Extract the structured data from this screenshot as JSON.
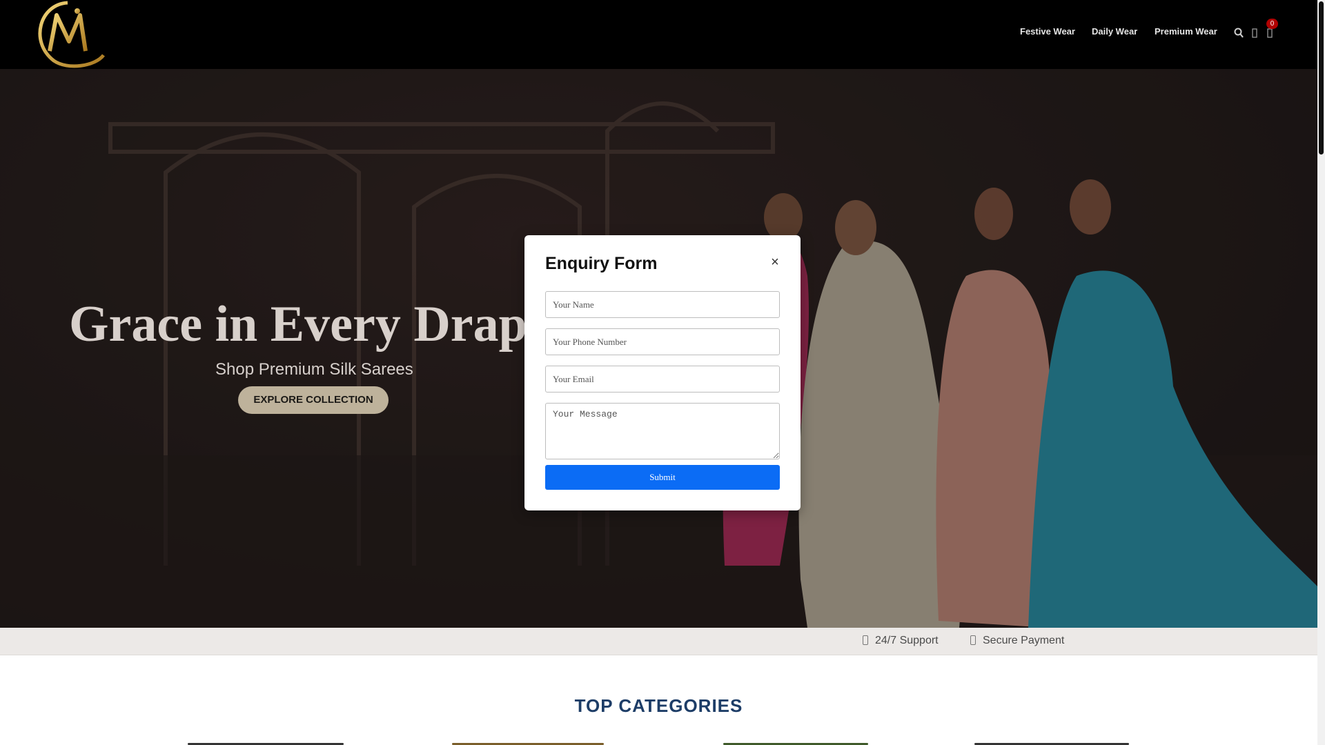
{
  "header": {
    "logo_letters": "M",
    "nav": [
      "Festive Wear",
      "Daily Wear",
      "Premium Wear"
    ],
    "cart_count": "0",
    "icons": [
      "search-icon",
      "user-icon",
      "cart-icon"
    ]
  },
  "hero": {
    "title": "Grace in Every Drap",
    "subtitle": "Shop Premium Silk Sarees",
    "cta": "EXPLORE COLLECTION"
  },
  "features": [
    {
      "icon": "headset-icon",
      "label": "24/7 Support"
    },
    {
      "icon": "lock-icon",
      "label": "Secure Payment"
    }
  ],
  "categories": {
    "title": "TOP CATEGORIES"
  },
  "modal": {
    "title": "Enquiry Form",
    "close": "×",
    "name_placeholder": "Your Name",
    "phone_placeholder": "Your Phone Number",
    "email_placeholder": "Your Email",
    "message_placeholder": "Your Message",
    "submit": "Submit"
  },
  "colors": {
    "header_bg": "#000000",
    "submit_bg": "#0b6cf5",
    "accent_gold": "#c9a43a",
    "badge_red": "#b10000",
    "category_title": "#1d3d67"
  }
}
